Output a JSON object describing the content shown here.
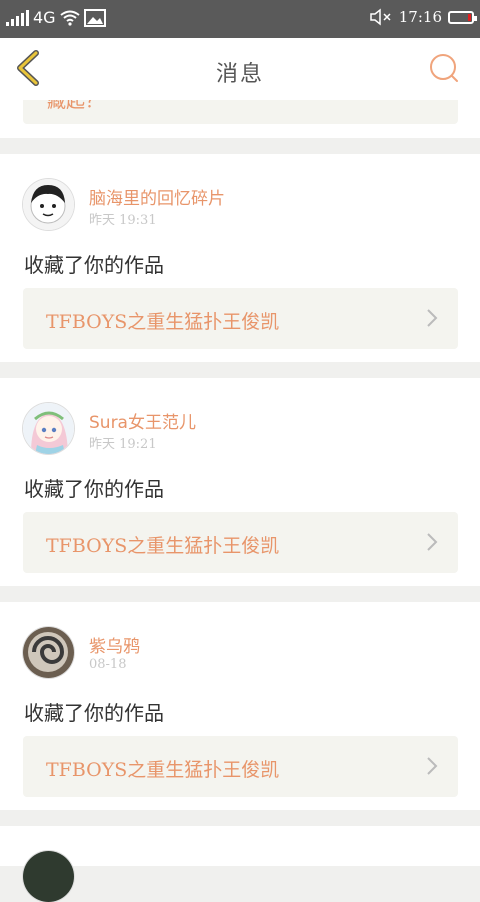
{
  "status_bar": {
    "network": "4G",
    "time": "17:16"
  },
  "header": {
    "title": "消息"
  },
  "top_partial": {
    "link_text": "藏起？"
  },
  "messages": [
    {
      "username": "脑海里的回忆碎片",
      "time": "昨天 19:31",
      "action": "收藏了你的作品",
      "work_title": "TFBOYS之重生猛扑王俊凯"
    },
    {
      "username": "Sura女王范儿",
      "time": "昨天 19:21",
      "action": "收藏了你的作品",
      "work_title": "TFBOYS之重生猛扑王俊凯"
    },
    {
      "username": "紫乌鸦",
      "time": "08-18",
      "action": "收藏了你的作品",
      "work_title": "TFBOYS之重生猛扑王俊凯"
    }
  ],
  "icons": {
    "back": "chevron-left-icon",
    "search": "search-icon",
    "signal": "signal-icon",
    "wifi": "wifi-icon",
    "image": "image-icon",
    "mute": "mute-icon",
    "battery": "battery-icon",
    "chevron": "chevron-right-icon"
  },
  "colors": {
    "accent": "#e8956a",
    "back_icon": "#e8c43a",
    "status_bar": "#5a5a5a"
  }
}
